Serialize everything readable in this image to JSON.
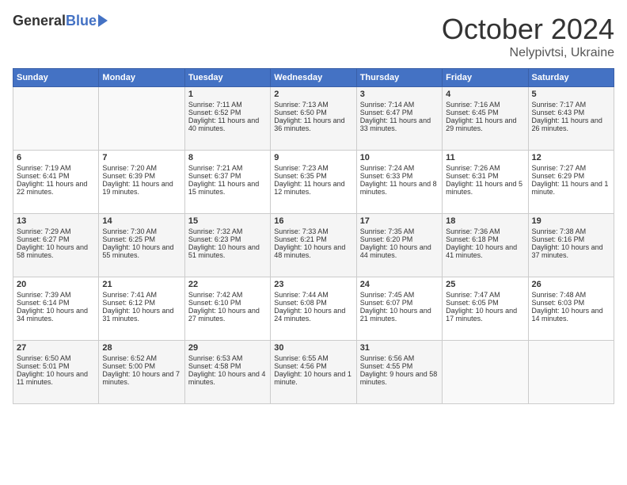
{
  "logo": {
    "general": "General",
    "blue": "Blue"
  },
  "header": {
    "month": "October 2024",
    "location": "Nelypivtsi, Ukraine"
  },
  "weekdays": [
    "Sunday",
    "Monday",
    "Tuesday",
    "Wednesday",
    "Thursday",
    "Friday",
    "Saturday"
  ],
  "weeks": [
    [
      {
        "day": "",
        "sunrise": "",
        "sunset": "",
        "daylight": ""
      },
      {
        "day": "",
        "sunrise": "",
        "sunset": "",
        "daylight": ""
      },
      {
        "day": "1",
        "sunrise": "Sunrise: 7:11 AM",
        "sunset": "Sunset: 6:52 PM",
        "daylight": "Daylight: 11 hours and 40 minutes."
      },
      {
        "day": "2",
        "sunrise": "Sunrise: 7:13 AM",
        "sunset": "Sunset: 6:50 PM",
        "daylight": "Daylight: 11 hours and 36 minutes."
      },
      {
        "day": "3",
        "sunrise": "Sunrise: 7:14 AM",
        "sunset": "Sunset: 6:47 PM",
        "daylight": "Daylight: 11 hours and 33 minutes."
      },
      {
        "day": "4",
        "sunrise": "Sunrise: 7:16 AM",
        "sunset": "Sunset: 6:45 PM",
        "daylight": "Daylight: 11 hours and 29 minutes."
      },
      {
        "day": "5",
        "sunrise": "Sunrise: 7:17 AM",
        "sunset": "Sunset: 6:43 PM",
        "daylight": "Daylight: 11 hours and 26 minutes."
      }
    ],
    [
      {
        "day": "6",
        "sunrise": "Sunrise: 7:19 AM",
        "sunset": "Sunset: 6:41 PM",
        "daylight": "Daylight: 11 hours and 22 minutes."
      },
      {
        "day": "7",
        "sunrise": "Sunrise: 7:20 AM",
        "sunset": "Sunset: 6:39 PM",
        "daylight": "Daylight: 11 hours and 19 minutes."
      },
      {
        "day": "8",
        "sunrise": "Sunrise: 7:21 AM",
        "sunset": "Sunset: 6:37 PM",
        "daylight": "Daylight: 11 hours and 15 minutes."
      },
      {
        "day": "9",
        "sunrise": "Sunrise: 7:23 AM",
        "sunset": "Sunset: 6:35 PM",
        "daylight": "Daylight: 11 hours and 12 minutes."
      },
      {
        "day": "10",
        "sunrise": "Sunrise: 7:24 AM",
        "sunset": "Sunset: 6:33 PM",
        "daylight": "Daylight: 11 hours and 8 minutes."
      },
      {
        "day": "11",
        "sunrise": "Sunrise: 7:26 AM",
        "sunset": "Sunset: 6:31 PM",
        "daylight": "Daylight: 11 hours and 5 minutes."
      },
      {
        "day": "12",
        "sunrise": "Sunrise: 7:27 AM",
        "sunset": "Sunset: 6:29 PM",
        "daylight": "Daylight: 11 hours and 1 minute."
      }
    ],
    [
      {
        "day": "13",
        "sunrise": "Sunrise: 7:29 AM",
        "sunset": "Sunset: 6:27 PM",
        "daylight": "Daylight: 10 hours and 58 minutes."
      },
      {
        "day": "14",
        "sunrise": "Sunrise: 7:30 AM",
        "sunset": "Sunset: 6:25 PM",
        "daylight": "Daylight: 10 hours and 55 minutes."
      },
      {
        "day": "15",
        "sunrise": "Sunrise: 7:32 AM",
        "sunset": "Sunset: 6:23 PM",
        "daylight": "Daylight: 10 hours and 51 minutes."
      },
      {
        "day": "16",
        "sunrise": "Sunrise: 7:33 AM",
        "sunset": "Sunset: 6:21 PM",
        "daylight": "Daylight: 10 hours and 48 minutes."
      },
      {
        "day": "17",
        "sunrise": "Sunrise: 7:35 AM",
        "sunset": "Sunset: 6:20 PM",
        "daylight": "Daylight: 10 hours and 44 minutes."
      },
      {
        "day": "18",
        "sunrise": "Sunrise: 7:36 AM",
        "sunset": "Sunset: 6:18 PM",
        "daylight": "Daylight: 10 hours and 41 minutes."
      },
      {
        "day": "19",
        "sunrise": "Sunrise: 7:38 AM",
        "sunset": "Sunset: 6:16 PM",
        "daylight": "Daylight: 10 hours and 37 minutes."
      }
    ],
    [
      {
        "day": "20",
        "sunrise": "Sunrise: 7:39 AM",
        "sunset": "Sunset: 6:14 PM",
        "daylight": "Daylight: 10 hours and 34 minutes."
      },
      {
        "day": "21",
        "sunrise": "Sunrise: 7:41 AM",
        "sunset": "Sunset: 6:12 PM",
        "daylight": "Daylight: 10 hours and 31 minutes."
      },
      {
        "day": "22",
        "sunrise": "Sunrise: 7:42 AM",
        "sunset": "Sunset: 6:10 PM",
        "daylight": "Daylight: 10 hours and 27 minutes."
      },
      {
        "day": "23",
        "sunrise": "Sunrise: 7:44 AM",
        "sunset": "Sunset: 6:08 PM",
        "daylight": "Daylight: 10 hours and 24 minutes."
      },
      {
        "day": "24",
        "sunrise": "Sunrise: 7:45 AM",
        "sunset": "Sunset: 6:07 PM",
        "daylight": "Daylight: 10 hours and 21 minutes."
      },
      {
        "day": "25",
        "sunrise": "Sunrise: 7:47 AM",
        "sunset": "Sunset: 6:05 PM",
        "daylight": "Daylight: 10 hours and 17 minutes."
      },
      {
        "day": "26",
        "sunrise": "Sunrise: 7:48 AM",
        "sunset": "Sunset: 6:03 PM",
        "daylight": "Daylight: 10 hours and 14 minutes."
      }
    ],
    [
      {
        "day": "27",
        "sunrise": "Sunrise: 6:50 AM",
        "sunset": "Sunset: 5:01 PM",
        "daylight": "Daylight: 10 hours and 11 minutes."
      },
      {
        "day": "28",
        "sunrise": "Sunrise: 6:52 AM",
        "sunset": "Sunset: 5:00 PM",
        "daylight": "Daylight: 10 hours and 7 minutes."
      },
      {
        "day": "29",
        "sunrise": "Sunrise: 6:53 AM",
        "sunset": "Sunset: 4:58 PM",
        "daylight": "Daylight: 10 hours and 4 minutes."
      },
      {
        "day": "30",
        "sunrise": "Sunrise: 6:55 AM",
        "sunset": "Sunset: 4:56 PM",
        "daylight": "Daylight: 10 hours and 1 minute."
      },
      {
        "day": "31",
        "sunrise": "Sunrise: 6:56 AM",
        "sunset": "Sunset: 4:55 PM",
        "daylight": "Daylight: 9 hours and 58 minutes."
      },
      {
        "day": "",
        "sunrise": "",
        "sunset": "",
        "daylight": ""
      },
      {
        "day": "",
        "sunrise": "",
        "sunset": "",
        "daylight": ""
      }
    ]
  ]
}
